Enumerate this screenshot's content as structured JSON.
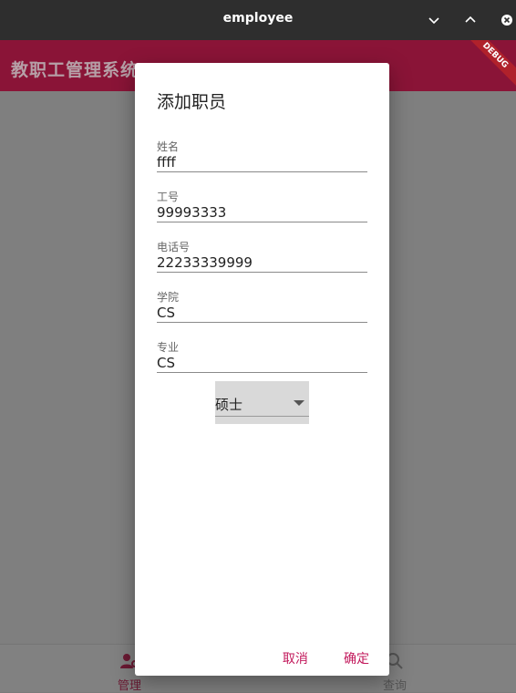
{
  "window": {
    "title": "employee",
    "minimize_icon": "chevron-down-icon",
    "maximize_icon": "chevron-up-icon",
    "close_icon": "close-circle-icon"
  },
  "appbar": {
    "title": "教职工管理系统",
    "debug_banner": "DEBUG",
    "color": "#8a1437"
  },
  "bottomnav": {
    "items": [
      {
        "label": "管理",
        "icon": "person-gear-icon",
        "active": true
      },
      {
        "label": "查询",
        "icon": "search-icon",
        "active": false
      }
    ]
  },
  "dialog": {
    "title": "添加职员",
    "fields": [
      {
        "label": "姓名",
        "value": "ffff"
      },
      {
        "label": "工号",
        "value": "99993333"
      },
      {
        "label": "电话号",
        "value": "22233339999"
      },
      {
        "label": "学院",
        "value": "CS"
      },
      {
        "label": "专业",
        "value": "CS"
      }
    ],
    "degree": {
      "selected": "硕士"
    },
    "cancel_label": "取消",
    "confirm_label": "确定",
    "accent": "#c2185b"
  }
}
